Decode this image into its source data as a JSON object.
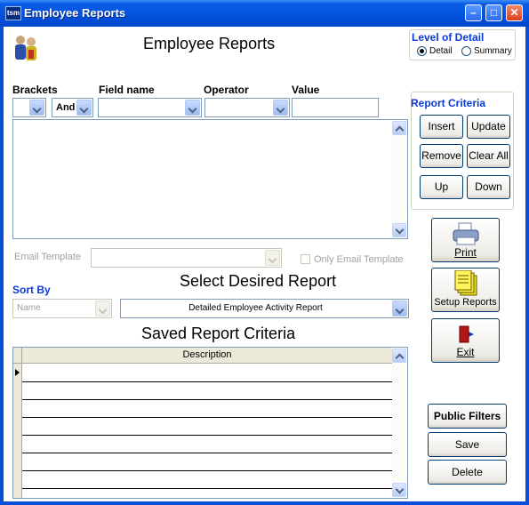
{
  "window": {
    "title": "Employee Reports",
    "app_icon_text": "tsm"
  },
  "header": {
    "title": "Employee Reports"
  },
  "level_of_detail": {
    "label": "Level of Detail",
    "options": [
      "Detail",
      "Summary"
    ],
    "selected": "Detail"
  },
  "criteria_row": {
    "brackets_label": "Brackets",
    "field_name_label": "Field name",
    "operator_label": "Operator",
    "value_label": "Value",
    "and_or_value": "And"
  },
  "report_criteria": {
    "label": "Report Criteria",
    "insert": "Insert",
    "update": "Update",
    "remove": "Remove",
    "clear_all": "Clear All",
    "up": "Up",
    "down": "Down"
  },
  "actions": {
    "print": "Print",
    "setup_reports": "Setup Reports",
    "exit": "Exit"
  },
  "email": {
    "template_label": "Email Template",
    "only_email_template": "Only Email Template"
  },
  "sort_by": {
    "label": "Sort By",
    "value": "Name"
  },
  "report": {
    "heading": "Select Desired Report",
    "value": "Detailed Employee Activity Report"
  },
  "saved": {
    "heading": "Saved Report Criteria",
    "column": "Description"
  },
  "bottom_buttons": {
    "public_filters": "Public Filters",
    "save": "Save",
    "delete": "Delete"
  }
}
